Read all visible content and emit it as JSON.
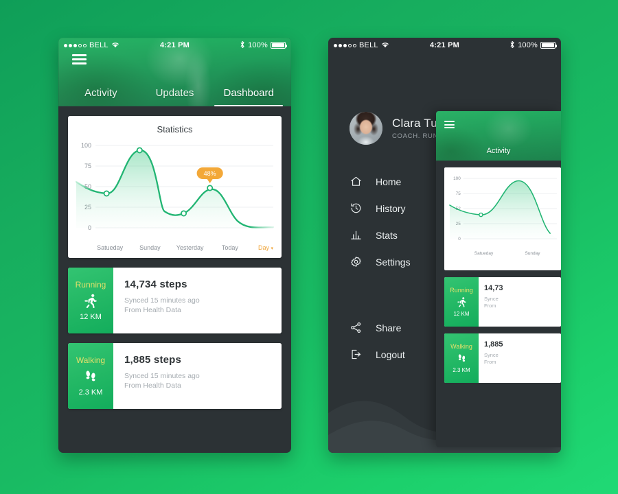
{
  "statusbar": {
    "carrier": "BELL",
    "time": "4:21 PM",
    "battery": "100%",
    "wifi_icon": "wifi-icon",
    "bluetooth_icon": "bluetooth-icon",
    "signal_dots_filled": 3,
    "signal_dots_total": 5
  },
  "dashboard": {
    "menu_icon": "hamburger-icon",
    "tabs": [
      {
        "label": "Activity",
        "active": false
      },
      {
        "label": "Updates",
        "active": false
      },
      {
        "label": "Dashboard",
        "active": true
      }
    ],
    "chart_card": {
      "title": "Statistics",
      "range_label": "Day",
      "range_caret": "▾"
    },
    "activities": [
      {
        "kind": "Running",
        "icon": "running-icon",
        "distance": "12 KM",
        "steps": "14,734 steps",
        "sync_line1": "Synced 15 minutes ago",
        "sync_line2": "From Health Data"
      },
      {
        "kind": "Walking",
        "icon": "footsteps-icon",
        "distance": "2.3 KM",
        "steps": "1,885 steps",
        "sync_line1": "Synced 15 minutes ago",
        "sync_line2": "From Health Data"
      }
    ]
  },
  "menu": {
    "profile": {
      "name": "Clara Tucker",
      "role": "COACH. RUNNING",
      "avatar": "avatar"
    },
    "items": [
      {
        "label": "Home",
        "icon": "home-icon"
      },
      {
        "label": "History",
        "icon": "history-icon"
      },
      {
        "label": "Stats",
        "icon": "bar-chart-icon"
      },
      {
        "label": "Settings",
        "icon": "gear-icon"
      },
      {
        "label": "Share",
        "icon": "share-icon"
      },
      {
        "label": "Logout",
        "icon": "logout-icon"
      }
    ]
  },
  "preview": {
    "menu_icon": "hamburger-icon",
    "tab_label": "Activity",
    "activities": [
      {
        "kind": "Running",
        "icon": "running-icon",
        "distance": "12 KM",
        "steps": "14,73",
        "sync_line1": "Synce",
        "sync_line2": "From"
      },
      {
        "kind": "Walking",
        "icon": "footsteps-icon",
        "distance": "2.3 KM",
        "steps": "1,885",
        "sync_line1": "Synce",
        "sync_line2": "From"
      }
    ]
  },
  "colors": {
    "brand_green": "#1dbf68",
    "line_green": "#22b573",
    "accent_orange": "#f0a53a",
    "kind_yellow": "#e3e06a",
    "panel_dark": "#2c3235",
    "card_white": "#ffffff"
  },
  "chart_data": {
    "type": "area",
    "title": "Statistics",
    "xlabel": "",
    "ylabel": "",
    "categories": [
      "Satueday",
      "Sunday",
      "Yesterday",
      "Today"
    ],
    "values": [
      42,
      94,
      22,
      48
    ],
    "yticks": [
      0,
      25,
      50,
      75,
      100
    ],
    "ylim": [
      0,
      100
    ],
    "grid": true,
    "legend": "none",
    "annotations": [
      {
        "label": "48%",
        "category": "Today",
        "value": 48
      }
    ],
    "range_selector": "Day",
    "lead_in_value": 56,
    "tail_out_value": 1
  }
}
